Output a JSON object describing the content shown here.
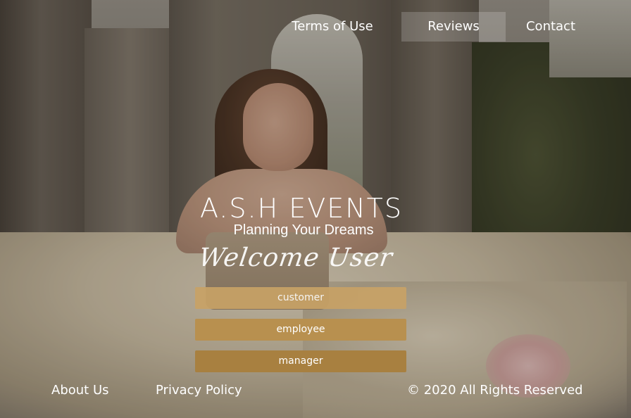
{
  "nav": {
    "items": [
      {
        "label": "Terms of Use"
      },
      {
        "label": "Reviews"
      },
      {
        "label": "Contact"
      }
    ]
  },
  "brand": {
    "title": "A.S.H EVENTS",
    "tagline": "Planning Your Dreams",
    "welcome": "Welcome User"
  },
  "roles": {
    "customer": "customer",
    "employee": "employee",
    "manager": "manager"
  },
  "footer": {
    "about": "About Us",
    "privacy": "Privacy Policy",
    "copyright": "© 2020 All Rights Reserved"
  },
  "colors": {
    "button_gold": "#c8a266",
    "text": "#ffffff"
  }
}
